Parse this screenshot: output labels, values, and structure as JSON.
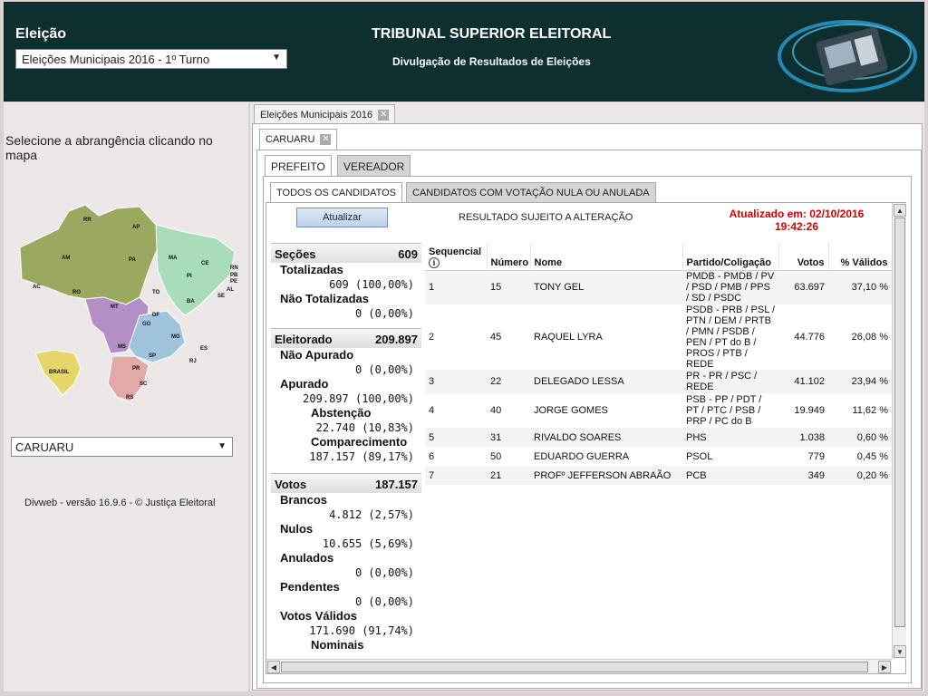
{
  "header": {
    "eleicao_label": "Eleição",
    "eleicao_selected": "Eleições Municipais 2016 - 1º Turno",
    "title": "TRIBUNAL SUPERIOR ELEITORAL",
    "subtitle": "Divulgação de Resultados de Eleições"
  },
  "left": {
    "instruction": "Selecione a abrangência clicando no mapa",
    "municipio_selected": "CARUARU",
    "version": "Divweb - versão 16.9.6 - © Justiça Eleitoral",
    "map_labels": [
      "RR",
      "AP",
      "AM",
      "PA",
      "MA",
      "CE",
      "RN",
      "PB",
      "PE",
      "AL",
      "SE",
      "PI",
      "AC",
      "RO",
      "TO",
      "BA",
      "MT",
      "DF",
      "GO",
      "MG",
      "ES",
      "MS",
      "SP",
      "RJ",
      "PR",
      "SC",
      "RS",
      "BRASIL"
    ]
  },
  "tabs": {
    "election_tab": "Eleições Municipais 2016",
    "city_tab": "CARUARU",
    "prefeito": "PREFEITO",
    "vereador": "VEREADOR",
    "todos": "TODOS OS CANDIDATOS",
    "nula": "CANDIDATOS COM VOTAÇÃO NULA OU ANULADA"
  },
  "toolbar": {
    "atualizar": "Atualizar",
    "aviso": "RESULTADO SUJEITO A ALTERAÇÃO",
    "atualizado_line1": "Atualizado em: 02/10/2016",
    "atualizado_line2": "19:42:26"
  },
  "stats": {
    "secoes_label": "Seções",
    "secoes_value": "609",
    "totalizadas_label": "Totalizadas",
    "totalizadas_value": "609 (100,00%)",
    "nao_totalizadas_label": "Não Totalizadas",
    "nao_totalizadas_value": "0 (0,00%)",
    "eleitorado_label": "Eleitorado",
    "eleitorado_value": "209.897",
    "nao_apurado_label": "Não Apurado",
    "nao_apurado_value": "0 (0,00%)",
    "apurado_label": "Apurado",
    "apurado_value": "209.897 (100,00%)",
    "abstencao_label": "Abstenção",
    "abstencao_value": "22.740 (10,83%)",
    "comparecimento_label": "Comparecimento",
    "comparecimento_value": "187.157 (89,17%)",
    "votos_label": "Votos",
    "votos_value": "187.157",
    "brancos_label": "Brancos",
    "brancos_value": "4.812 (2,57%)",
    "nulos_label": "Nulos",
    "nulos_value": "10.655 (5,69%)",
    "anulados_label": "Anulados",
    "anulados_value": "0 (0,00%)",
    "pendentes_label": "Pendentes",
    "pendentes_value": "0 (0,00%)",
    "validos_label": "Votos Válidos",
    "validos_value": "171.690 (91,74%)",
    "nominais_label": "Nominais"
  },
  "table": {
    "headers": [
      "Sequencial",
      "Número",
      "Nome",
      "Partido/Coligação",
      "Votos",
      "% Válidos"
    ],
    "rows": [
      {
        "seq": "1",
        "num": "15",
        "nome": "TONY GEL",
        "partido": "PMDB - PMDB / PV / PSD / PMB / PPS / SD / PSDC",
        "votos": "63.697",
        "pct": "37,10 %"
      },
      {
        "seq": "2",
        "num": "45",
        "nome": "RAQUEL LYRA",
        "partido": "PSDB - PRB / PSL / PTN / DEM / PRTB / PMN / PSDB / PEN / PT do B / PROS / PTB / REDE",
        "votos": "44.776",
        "pct": "26,08 %"
      },
      {
        "seq": "3",
        "num": "22",
        "nome": "DELEGADO LESSA",
        "partido": "PR - PR / PSC / REDE",
        "votos": "41.102",
        "pct": "23,94 %"
      },
      {
        "seq": "4",
        "num": "40",
        "nome": "JORGE GOMES",
        "partido": "PSB - PP / PDT / PT / PTC / PSB / PRP / PC do B",
        "votos": "19.949",
        "pct": "11,62 %"
      },
      {
        "seq": "5",
        "num": "31",
        "nome": "RIVALDO SOARES",
        "partido": "PHS",
        "votos": "1.038",
        "pct": "0,60 %"
      },
      {
        "seq": "6",
        "num": "50",
        "nome": "EDUARDO GUERRA",
        "partido": "PSOL",
        "votos": "779",
        "pct": "0,45 %"
      },
      {
        "seq": "7",
        "num": "21",
        "nome": "PROFº JEFFERSON ABRAÃO",
        "partido": "PCB",
        "votos": "349",
        "pct": "0,20 %"
      }
    ]
  },
  "colors": {
    "header_bg": "#0d2f2f",
    "alert_red": "#d40000"
  }
}
